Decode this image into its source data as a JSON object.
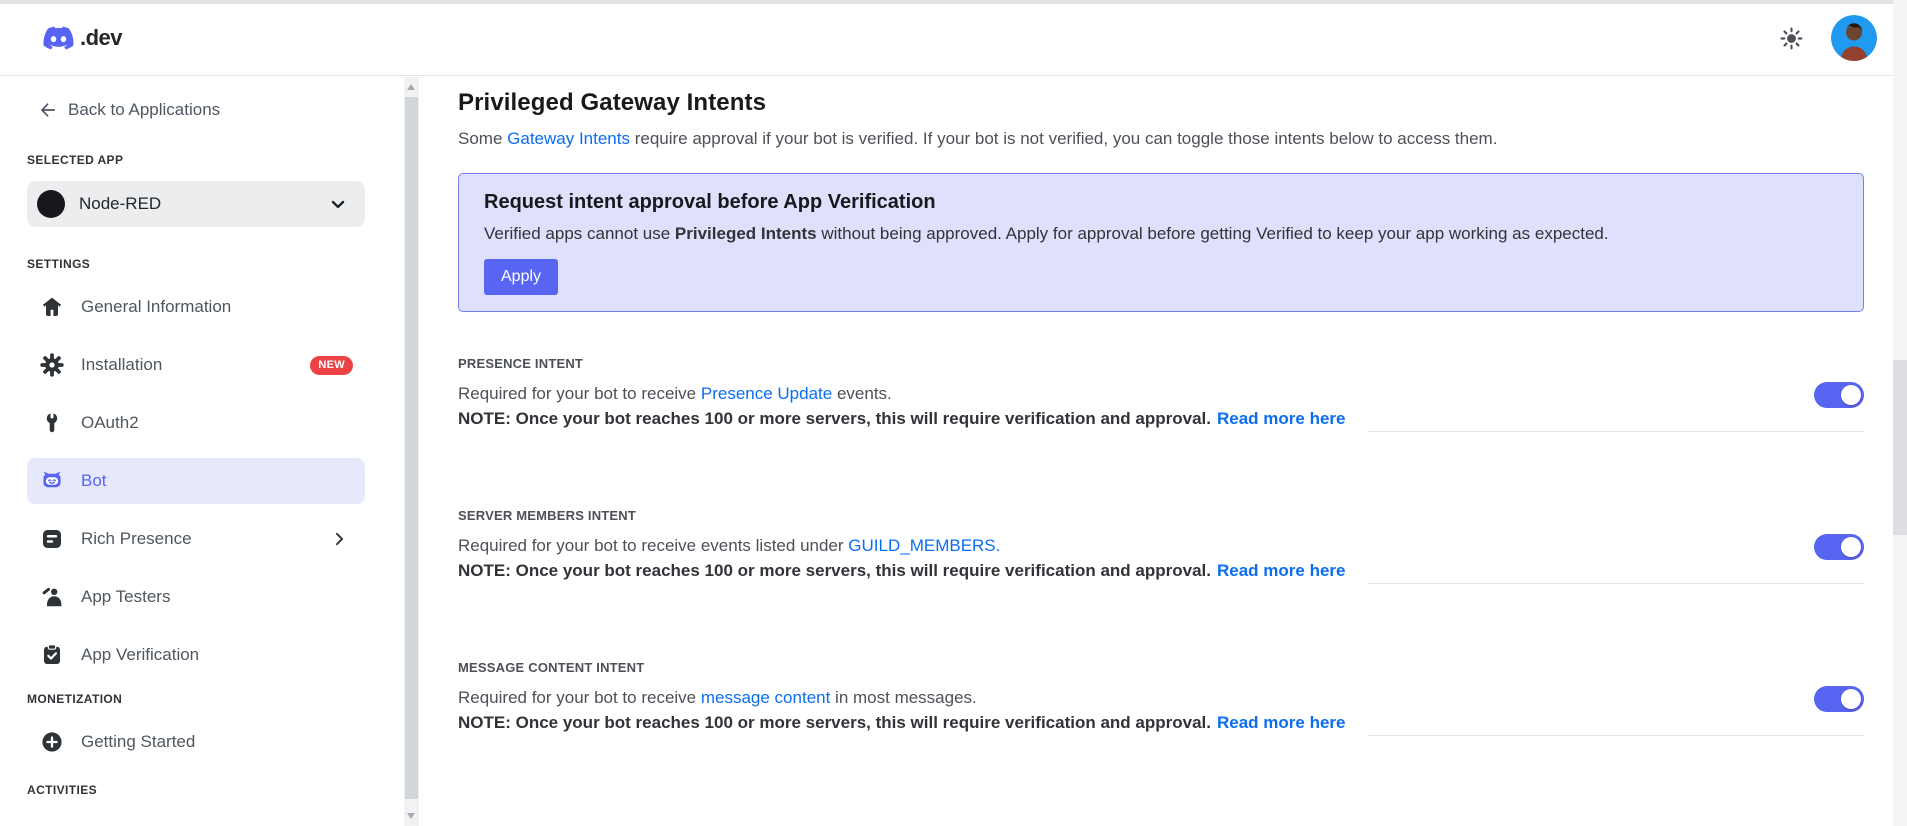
{
  "header": {
    "brand": ".dev"
  },
  "sidebar": {
    "back": "Back to Applications",
    "selected_app_heading": "SELECTED APP",
    "app_name": "Node-RED",
    "groups": [
      {
        "heading": "SETTINGS",
        "items": [
          {
            "label": "General Information"
          },
          {
            "label": "Installation",
            "badge": "NEW"
          },
          {
            "label": "OAuth2"
          },
          {
            "label": "Bot",
            "active": true
          },
          {
            "label": "Rich Presence",
            "chevron": true
          },
          {
            "label": "App Testers"
          },
          {
            "label": "App Verification"
          }
        ]
      },
      {
        "heading": "MONETIZATION",
        "items": [
          {
            "label": "Getting Started"
          }
        ]
      },
      {
        "heading": "ACTIVITIES",
        "items": []
      }
    ]
  },
  "main": {
    "title": "Privileged Gateway Intents",
    "intro": {
      "pre": "Some ",
      "link": "Gateway Intents",
      "post": " require approval if your bot is verified. If your bot is not verified, you can toggle those intents below to access them."
    },
    "callout": {
      "title": "Request intent approval before App Verification",
      "body_pre": "Verified apps cannot use ",
      "body_bold": "Privileged Intents",
      "body_post": " without being approved. Apply for approval before getting Verified to keep your app working as expected.",
      "button": "Apply"
    },
    "note_text": "NOTE: Once your bot reaches 100 or more servers, this will require verification and approval.",
    "note_link": "Read more here",
    "intents": [
      {
        "label": "PRESENCE INTENT",
        "desc_pre": "Required for your bot to receive ",
        "desc_link": "Presence Update",
        "desc_post": " events.",
        "enabled": true
      },
      {
        "label": "SERVER MEMBERS INTENT",
        "desc_pre": "Required for your bot to receive events listed under ",
        "desc_link": "GUILD_MEMBERS.",
        "desc_post": "",
        "enabled": true
      },
      {
        "label": "MESSAGE CONTENT INTENT",
        "desc_pre": "Required for your bot to receive ",
        "desc_link": "message content",
        "desc_post": " in most messages.",
        "enabled": true
      }
    ]
  },
  "colors": {
    "blurple": "#5865f2",
    "link_blue": "#0a6ef4",
    "badge_red": "#ed4245",
    "callout_bg": "#dfe1fc",
    "callout_border": "#7680ee",
    "active_item_bg": "#e6e8fc",
    "avatar_bg": "#1f9af0",
    "divider": "#e3e5e8"
  }
}
